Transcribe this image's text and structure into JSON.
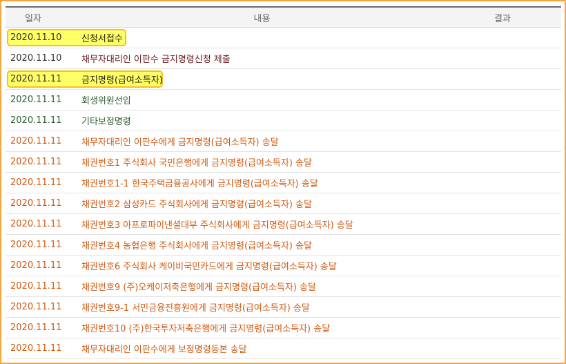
{
  "header": {
    "date": "일자",
    "content": "내용",
    "result": "결과"
  },
  "rows": [
    {
      "date": "2020.11.10",
      "content": "신청서접수",
      "style": "dark",
      "highlight": true
    },
    {
      "date": "2020.11.10",
      "content": "채무자대리인 이판수 금지명령신청 제출",
      "style": "maroon",
      "highlight": false
    },
    {
      "date": "2020.11.11",
      "content": "금지명령(급여소득자)",
      "style": "dark",
      "highlight": true
    },
    {
      "date": "2020.11.11",
      "content": "회생위원선임",
      "style": "green",
      "highlight": false
    },
    {
      "date": "2020.11.11",
      "content": "기타보정명령",
      "style": "green",
      "highlight": false
    },
    {
      "date": "2020.11.11",
      "content": "채무자대리인 이판수에게 금지명령(급여소득자) 송달",
      "style": "orange",
      "highlight": false
    },
    {
      "date": "2020.11.11",
      "content": "채권번호1 주식회사 국민은행에게 금지명령(급여소득자) 송달",
      "style": "orange",
      "highlight": false
    },
    {
      "date": "2020.11.11",
      "content": "채권번호1-1 한국주택금융공사에게 금지명령(급여소득자) 송달",
      "style": "orange",
      "highlight": false
    },
    {
      "date": "2020.11.11",
      "content": "채권번호2 삼성카드 주식회사에게 금지명령(급여소득자) 송달",
      "style": "orange",
      "highlight": false
    },
    {
      "date": "2020.11.11",
      "content": "채권번호3 아프로파이낸셜대부 주식회사에게 금지명령(급여소득자) 송달",
      "style": "orange",
      "highlight": false
    },
    {
      "date": "2020.11.11",
      "content": "채권번호4 농협은행 주식회사에게 금지명령(급여소득자) 송달",
      "style": "orange",
      "highlight": false
    },
    {
      "date": "2020.11.11",
      "content": "채권번호6 주식회사 케이비국민카드에게 금지명령(급여소득자) 송달",
      "style": "orange",
      "highlight": false
    },
    {
      "date": "2020.11.11",
      "content": "채권번호9 (주)오케이저축은행에게 금지명령(급여소득자) 송달",
      "style": "orange",
      "highlight": false
    },
    {
      "date": "2020.11.11",
      "content": "채권번호9-1 서민금융진흥원에게 금지명령(급여소득자) 송달",
      "style": "orange",
      "highlight": false
    },
    {
      "date": "2020.11.11",
      "content": "채권번호10 (주)한국투자저축은행에게 금지명령(급여소득자) 송달",
      "style": "orange",
      "highlight": false
    },
    {
      "date": "2020.11.11",
      "content": "채무자대리인 이판수에게 보정명령등본 송달",
      "style": "orange",
      "highlight": false
    }
  ],
  "colors": {
    "frame_border": "#f2a640",
    "highlight_fill": "#ffff66",
    "highlight_border": "#f3c11c",
    "served_text": "#cf5a12",
    "order_text": "#2f5d2f",
    "filing_text": "#6a1f24"
  }
}
